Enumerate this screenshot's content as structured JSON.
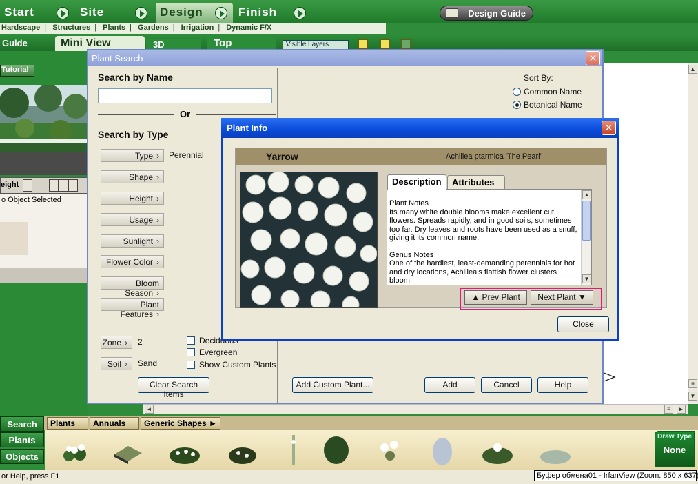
{
  "top_tabs": [
    "Start",
    "Site",
    "Design",
    "Finish"
  ],
  "guide_button": "Design Guide",
  "subnav": [
    "Hardscape",
    "Structures",
    "Plants",
    "Gardens",
    "Irrigation",
    "Dynamic F/X"
  ],
  "view_tabs": {
    "guide": "Guide",
    "mini": "Mini View",
    "three_d": "3D",
    "top": "Top",
    "visible_layers": "Visible Layers"
  },
  "left": {
    "tutorial": "Tutorial",
    "height_label": "eight",
    "status": "o Object Selected"
  },
  "plant_search": {
    "title": "Plant Search",
    "search_by_name": "Search by Name",
    "or": "Or",
    "search_by_type": "Search by Type",
    "type_buttons": [
      "Type",
      "Shape",
      "Height",
      "Usage",
      "Sunlight",
      "Flower Color",
      "Bloom Season",
      "Plant Features"
    ],
    "type_value": "Perennial",
    "zone_label": "Zone",
    "zone_value": "2",
    "soil_label": "Soil",
    "soil_value": "Sand",
    "checkboxes": [
      "Deciduous",
      "Evergreen",
      "Show Custom Plants"
    ],
    "clear_button": "Clear Search Items",
    "sort_by": "Sort By:",
    "sort_options": [
      "Common Name",
      "Botanical Name"
    ],
    "add_custom": "Add Custom Plant...",
    "add": "Add",
    "cancel": "Cancel",
    "help": "Help"
  },
  "plant_info": {
    "title": "Plant Info",
    "common_name": "Yarrow",
    "botanical_name": "Achillea ptarmica 'The Pearl'",
    "tabs": [
      "Description",
      "Attributes"
    ],
    "plant_notes_heading": "Plant Notes",
    "plant_notes": "Its many white double blooms make excellent cut flowers. Spreads rapidly, and in good soils, sometimes too far. Dry leaves and roots have been used as a snuff, giving it its common name.",
    "genus_notes_heading": "Genus Notes",
    "genus_notes": "One of the hardiest, least-demanding perennials for hot and dry locations, Achillea's flattish flower clusters bloom",
    "prev": "Prev Plant",
    "next": "Next Plant",
    "close": "Close"
  },
  "palette": {
    "side_buttons": [
      "Search",
      "Plants",
      "Objects"
    ],
    "tabs": [
      "Plants",
      "Annuals",
      "Generic Shapes"
    ],
    "draw_type": "Draw Type",
    "draw_value": "None"
  },
  "status": {
    "left": "or Help, press F1",
    "right": "Буфер обмена01 - IrfanView (Zoom: 850 x 637)"
  },
  "colors": {
    "accent_green": "#2a8a36",
    "xp_title": "#0a4bd8",
    "highlight": "#e2197a"
  }
}
